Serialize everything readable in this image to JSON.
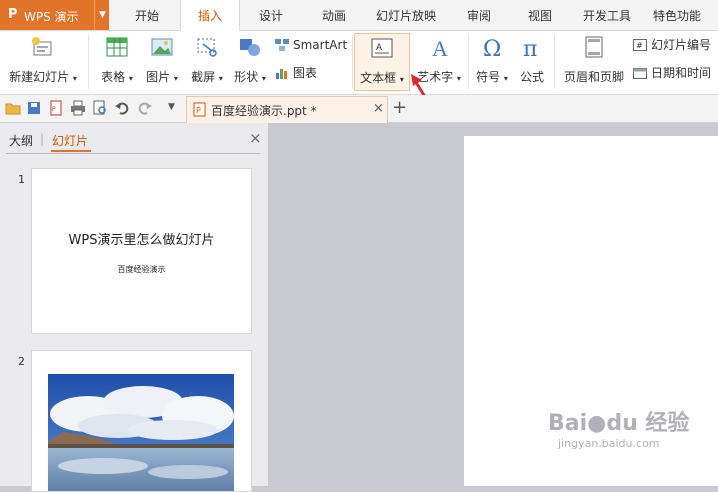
{
  "app": {
    "logo": "P",
    "name": "WPS 演示"
  },
  "menu_tabs": [
    "开始",
    "插入",
    "设计",
    "动画",
    "幻灯片放映",
    "审阅",
    "视图",
    "开发工具",
    "特色功能"
  ],
  "active_tab": "插入",
  "ribbon": {
    "new_slide": "新建幻灯片",
    "table": "表格",
    "picture": "图片",
    "screenshot": "截屏",
    "shape": "形状",
    "smartart": "SmartArt",
    "chart": "图表",
    "textbox": "文本框",
    "wordart": "艺术字",
    "symbol": "符号",
    "formula": "公式",
    "header_footer": "页眉和页脚",
    "slide_number": "幻灯片编号",
    "date_time": "日期和时间"
  },
  "document_tab": {
    "title": "百度经验演示.ppt *",
    "close": "×",
    "add": "+"
  },
  "panel": {
    "tab_outline": "大纲",
    "divider": "|",
    "tab_slides": "幻灯片",
    "close": "×",
    "slides": [
      {
        "number": "1",
        "title": "WPS演示里怎么做幻灯片",
        "subtitle": "百度经验演示"
      },
      {
        "number": "2"
      }
    ]
  },
  "watermark": {
    "logo": "Bai",
    "paw": "●",
    "suffix": "du 经验",
    "url": "jingyan.baidu.com"
  },
  "colors": {
    "accent": "#e2742a",
    "active_tab_text": "#d35400",
    "arrow": "#d92b2b"
  }
}
